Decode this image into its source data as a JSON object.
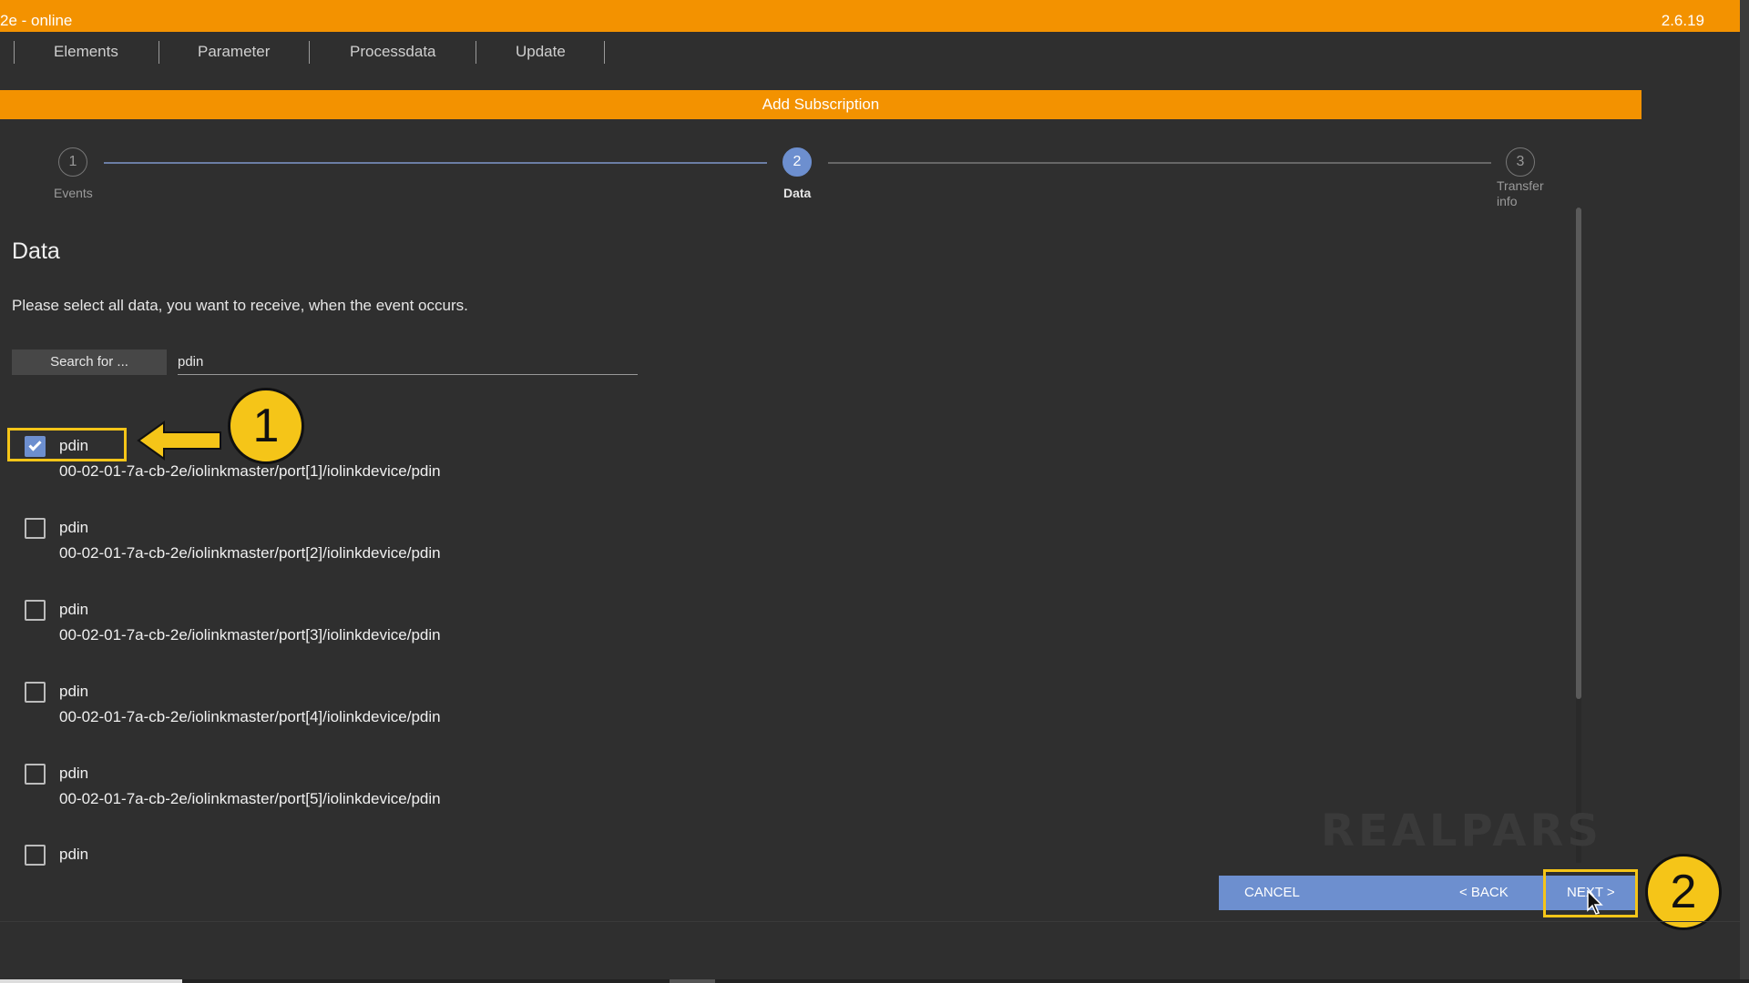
{
  "window": {
    "title": "2e - online",
    "version": "2.6.19"
  },
  "nav": {
    "tabs": [
      "Elements",
      "Parameter",
      "Processdata",
      "Update"
    ]
  },
  "dialog": {
    "title": "Add Subscription"
  },
  "stepper": {
    "steps": [
      {
        "number": "1",
        "label": "Events"
      },
      {
        "number": "2",
        "label": "Data"
      },
      {
        "number": "3",
        "label": "Transfer info"
      }
    ],
    "active_step": 2
  },
  "section": {
    "title": "Data",
    "instructions": "Please select all data, you want to receive, when the event occurs."
  },
  "search": {
    "label": "Search for ...",
    "value": "pdin"
  },
  "items": [
    {
      "label": "pdin",
      "path": "00-02-01-7a-cb-2e/iolinkmaster/port[1]/iolinkdevice/pdin",
      "checked": true
    },
    {
      "label": "pdin",
      "path": "00-02-01-7a-cb-2e/iolinkmaster/port[2]/iolinkdevice/pdin",
      "checked": false
    },
    {
      "label": "pdin",
      "path": "00-02-01-7a-cb-2e/iolinkmaster/port[3]/iolinkdevice/pdin",
      "checked": false
    },
    {
      "label": "pdin",
      "path": "00-02-01-7a-cb-2e/iolinkmaster/port[4]/iolinkdevice/pdin",
      "checked": false
    },
    {
      "label": "pdin",
      "path": "00-02-01-7a-cb-2e/iolinkmaster/port[5]/iolinkdevice/pdin",
      "checked": false
    },
    {
      "label": "pdin",
      "path": "",
      "checked": false
    }
  ],
  "buttons": {
    "cancel": "CANCEL",
    "back": "< BACK",
    "next": "NEXT >"
  },
  "annotations": {
    "callout_1": "1",
    "callout_2": "2"
  },
  "watermark": "REALPARS",
  "colors": {
    "accent_orange": "#f39200",
    "accent_blue": "#6d8fcf",
    "highlight_yellow": "#f5c518",
    "background": "#2f2f2f"
  }
}
